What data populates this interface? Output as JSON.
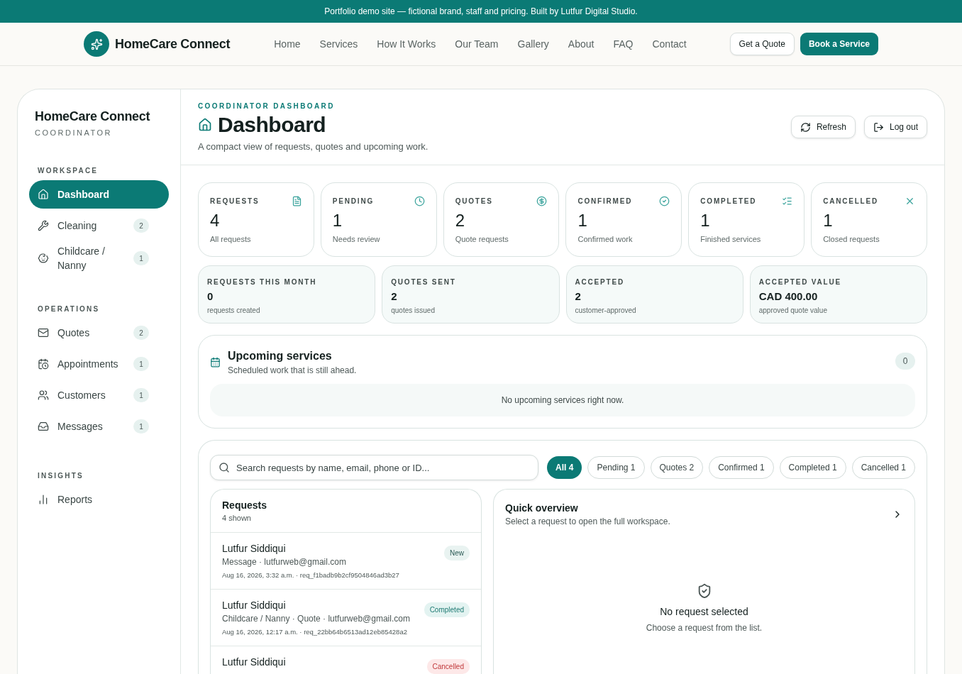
{
  "banner": "Portfolio demo site — fictional brand, staff and pricing. Built by Lutfur Digital Studio.",
  "header": {
    "brand": "HomeCare Connect",
    "nav": [
      "Home",
      "Services",
      "How It Works",
      "Our Team",
      "Gallery",
      "About",
      "FAQ",
      "Contact"
    ],
    "quote_button": "Get a Quote",
    "book_button": "Book a Service"
  },
  "sidebar": {
    "brand": "HomeCare Connect",
    "role": "COORDINATOR",
    "sections": [
      {
        "title": "WORKSPACE",
        "items": [
          {
            "label": "Dashboard",
            "selected": true
          },
          {
            "label": "Cleaning",
            "count": "2",
            "selected": false
          },
          {
            "label": "Childcare / Nanny",
            "count": "1",
            "selected": false
          }
        ]
      },
      {
        "title": "OPERATIONS",
        "items": [
          {
            "label": "Quotes",
            "count": "2",
            "selected": false
          },
          {
            "label": "Appointments",
            "count": "1",
            "selected": false
          },
          {
            "label": "Customers",
            "count": "1",
            "selected": false
          },
          {
            "label": "Messages",
            "count": "1",
            "selected": false
          }
        ]
      },
      {
        "title": "INSIGHTS",
        "items": [
          {
            "label": "Reports",
            "selected": false
          }
        ]
      }
    ]
  },
  "page": {
    "kicker": "COORDINATOR DASHBOARD",
    "title": "Dashboard",
    "subtitle": "A compact view of requests, quotes and upcoming work.",
    "refresh_button": "Refresh",
    "logout_button": "Log out"
  },
  "stats": [
    {
      "label": "REQUESTS",
      "value": "4",
      "note": "All requests"
    },
    {
      "label": "PENDING",
      "value": "1",
      "note": "Needs review"
    },
    {
      "label": "QUOTES",
      "value": "2",
      "note": "Quote requests"
    },
    {
      "label": "CONFIRMED",
      "value": "1",
      "note": "Confirmed work"
    },
    {
      "label": "COMPLETED",
      "value": "1",
      "note": "Finished services"
    },
    {
      "label": "CANCELLED",
      "value": "1",
      "note": "Closed requests"
    }
  ],
  "metrics": [
    {
      "label": "REQUESTS THIS MONTH",
      "value": "0",
      "note": "requests created"
    },
    {
      "label": "QUOTES SENT",
      "value": "2",
      "note": "quotes issued"
    },
    {
      "label": "ACCEPTED",
      "value": "2",
      "note": "customer-approved"
    },
    {
      "label": "ACCEPTED VALUE",
      "value": "CAD 400.00",
      "note": "approved quote value"
    }
  ],
  "upcoming": {
    "title": "Upcoming services",
    "subtitle": "Scheduled work that is still ahead.",
    "count": "0",
    "empty": "No upcoming services right now."
  },
  "search": {
    "placeholder": "Search requests by name, email, phone or ID..."
  },
  "filters": [
    {
      "label": "All 4",
      "selected": true
    },
    {
      "label": "Pending 1",
      "selected": false
    },
    {
      "label": "Quotes 2",
      "selected": false
    },
    {
      "label": "Confirmed 1",
      "selected": false
    },
    {
      "label": "Completed 1",
      "selected": false
    },
    {
      "label": "Cancelled 1",
      "selected": false
    }
  ],
  "requests": {
    "title": "Requests",
    "subtitle": "4 shown",
    "rows": [
      {
        "name": "Lutfur Siddiqui",
        "status": "New",
        "kind": "new",
        "meta": "Message · lutfurweb@gmail.com",
        "date": "Aug 16, 2026, 3:32 a.m. · req_f1badb9b2cf9504846ad3b27"
      },
      {
        "name": "Lutfur Siddiqui",
        "status": "Completed",
        "kind": "completed",
        "meta": "Childcare / Nanny · Quote · lutfurweb@gmail.com",
        "date": "Aug 16, 2026, 12:17 a.m. · req_22bb64b6513ad12eb85428a2"
      },
      {
        "name": "Lutfur Siddiqui",
        "status": "Cancelled",
        "kind": "cancelled"
      }
    ]
  },
  "overview": {
    "title": "Quick overview",
    "subtitle": "Select a request to open the full workspace.",
    "empty_title": "No request selected",
    "empty_text": "Choose a request from the list."
  }
}
